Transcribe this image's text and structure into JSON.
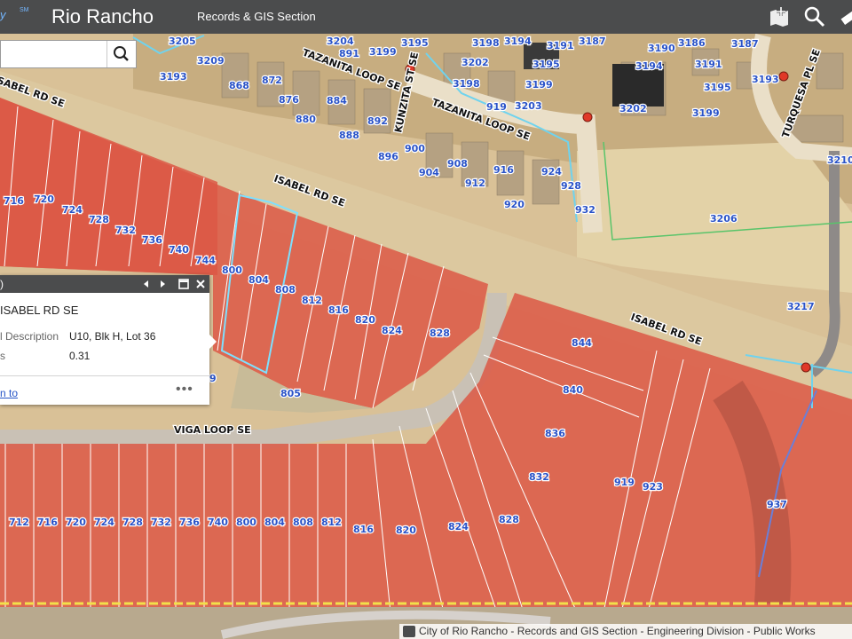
{
  "header": {
    "brand_fragment": "y",
    "brand_sm": "SM",
    "title": "Rio Rancho",
    "subtitle": "Records & GIS Section",
    "icons": [
      "add-map-icon",
      "search-tool-icon",
      "measure-icon"
    ]
  },
  "search": {
    "placeholder": "",
    "value": ""
  },
  "popup": {
    "bar_text": ")",
    "title": "ISABEL RD SE",
    "fields": [
      {
        "key": "l Description",
        "value": "U10, Blk H, Lot 36"
      },
      {
        "key": "s",
        "value": "0.31"
      }
    ],
    "zoom_link": "n to",
    "more": "•••"
  },
  "streets": {
    "tazanita_top": "TAZANITA LOOP SE",
    "kunzita": "KUNZITA ST SE",
    "tazanita_mid": "TAZANITA LOOP SE",
    "isabel_left": "ISABEL RD SE",
    "isabel_right": "ISABEL RD SE",
    "isabel_top": "ISABEL RD SE",
    "turquesa": "TURQUESA PL SE",
    "viga": "VIGA LOOP SE"
  },
  "parcels": {
    "top": [
      "3205",
      "3204",
      "891",
      "3199",
      "3195",
      "3198",
      "3194",
      "3191",
      "3187",
      "3190",
      "3186",
      "3187",
      "3209",
      "3193",
      "868",
      "872",
      "876",
      "880",
      "884",
      "888",
      "892",
      "3202",
      "3195",
      "3199",
      "3203",
      "919",
      "3198",
      "3194",
      "3191",
      "3195",
      "3202",
      "3199",
      "3193",
      "896",
      "900",
      "904",
      "908",
      "912",
      "916",
      "920",
      "924",
      "928",
      "932",
      "3206",
      "3210",
      "3217"
    ],
    "upper_red": [
      "716",
      "720",
      "724",
      "728",
      "732",
      "736",
      "740",
      "744",
      "800",
      "804",
      "808",
      "812",
      "816",
      "820",
      "824",
      "828"
    ],
    "right_red": [
      "844",
      "840",
      "836",
      "832",
      "828",
      "824",
      "820",
      "816",
      "919",
      "923",
      "937",
      "9",
      "805"
    ],
    "bottom_row": [
      "712",
      "716",
      "720",
      "724",
      "728",
      "732",
      "736",
      "740",
      "800",
      "804",
      "808",
      "812"
    ]
  },
  "attribution": "City of Rio Rancho - Records and GIS Section - Engineering Division - Public Works"
}
